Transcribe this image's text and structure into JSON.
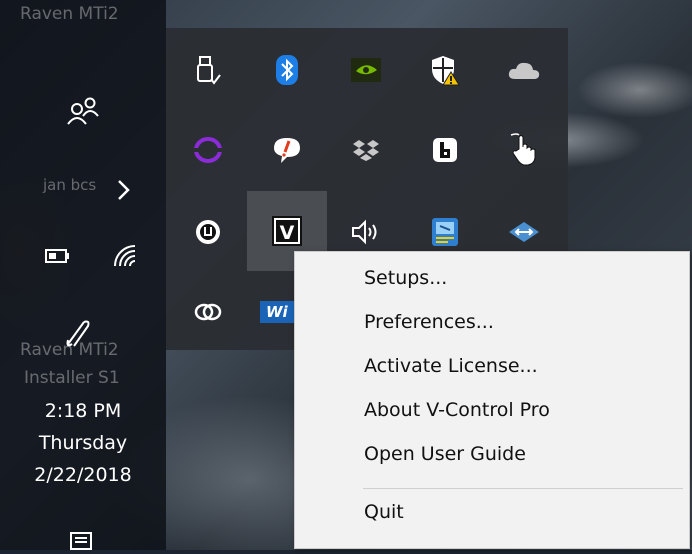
{
  "desktop": {
    "taskbar": {
      "top_title": "Raven MTi2",
      "user_label": "jan bcs",
      "bottom_title_1": "Raven MTi2",
      "bottom_title_2": "Installer S1",
      "clock_time": "2:18 PM",
      "clock_day": "Thursday",
      "clock_date": "2/22/2018",
      "icons": [
        "people-icon",
        "chevron-right-icon",
        "battery-icon",
        "wifi-icon",
        "pen-icon",
        "action-center-icon"
      ]
    }
  },
  "tray_flyout": {
    "rows": [
      [
        "usb-eject-icon",
        "bluetooth-icon",
        "nvidia-icon",
        "windows-defender-warning-icon",
        "onedrive-icon"
      ],
      [
        "purple-ring-icon",
        "chat-alert-icon",
        "dropbox-icon",
        "box-b-icon",
        "touch-hand-icon"
      ],
      [
        "omega-app-icon",
        "v-control-icon",
        "volume-icon",
        "blue-app-icon",
        "diamond-arrows-icon"
      ],
      [
        "link-rings-icon",
        "wi-logo-icon"
      ]
    ],
    "active_icon_letter": "V",
    "wi_logo_text": "Wi"
  },
  "context_menu": {
    "items": [
      "Setups...",
      "Preferences...",
      "Activate License...",
      "About V-Control Pro",
      "Open User Guide"
    ],
    "quit_label": "Quit"
  }
}
